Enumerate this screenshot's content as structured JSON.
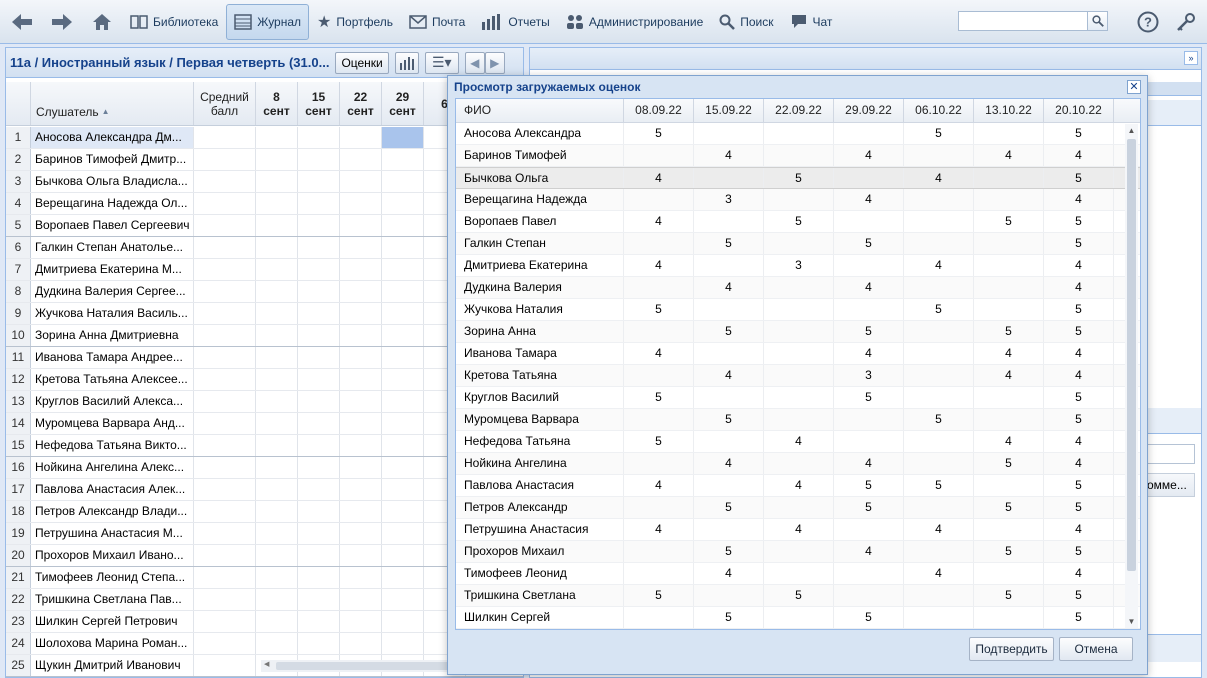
{
  "toolbar": {
    "library": "Библиотека",
    "journal": "Журнал",
    "portfolio": "Портфель",
    "mail": "Почта",
    "reports": "Отчеты",
    "admin": "Администрирование",
    "search": "Поиск",
    "chat": "Чат",
    "search_value": ""
  },
  "journal": {
    "title": "11а / Иностранный язык / Первая четверть (31.0...",
    "grades_button": "Оценки",
    "col_listener": "Слушатель",
    "col_avg_1": "Средний",
    "col_avg_2": "балл",
    "dates": [
      {
        "day": "8",
        "month": "сент"
      },
      {
        "day": "15",
        "month": "сент"
      },
      {
        "day": "22",
        "month": "сент"
      },
      {
        "day": "29",
        "month": "сент"
      },
      {
        "day": "6",
        "month": ""
      }
    ],
    "rows": [
      {
        "n": "1",
        "name": "Аносова Александра Дм..."
      },
      {
        "n": "2",
        "name": "Баринов Тимофей Дмитр..."
      },
      {
        "n": "3",
        "name": "Бычкова Ольга Владисла..."
      },
      {
        "n": "4",
        "name": "Верещагина Надежда Ол..."
      },
      {
        "n": "5",
        "name": "Воропаев Павел Сергеевич"
      },
      {
        "n": "6",
        "name": "Галкин Степан Анатолье..."
      },
      {
        "n": "7",
        "name": "Дмитриева Екатерина М..."
      },
      {
        "n": "8",
        "name": "Дудкина Валерия Сергее..."
      },
      {
        "n": "9",
        "name": "Жучкова Наталия Василь..."
      },
      {
        "n": "10",
        "name": "Зорина Анна Дмитриевна"
      },
      {
        "n": "11",
        "name": "Иванова Тамара Андрее..."
      },
      {
        "n": "12",
        "name": "Кретова Татьяна Алексее..."
      },
      {
        "n": "13",
        "name": "Круглов Василий Алекса..."
      },
      {
        "n": "14",
        "name": "Муромцева Варвара Анд..."
      },
      {
        "n": "15",
        "name": "Нефедова Татьяна Викто..."
      },
      {
        "n": "16",
        "name": "Нойкина Ангелина Алекс..."
      },
      {
        "n": "17",
        "name": "Павлова Анастасия Алек..."
      },
      {
        "n": "18",
        "name": "Петров Александр Влади..."
      },
      {
        "n": "19",
        "name": "Петрушина Анастасия М..."
      },
      {
        "n": "20",
        "name": "Прохоров Михаил Ивано..."
      },
      {
        "n": "21",
        "name": "Тимофеев Леонид Степа..."
      },
      {
        "n": "22",
        "name": "Тришкина Светлана Пав..."
      },
      {
        "n": "23",
        "name": "Шилкин Сергей Петрович"
      },
      {
        "n": "24",
        "name": "Шолохова Марина Роман..."
      },
      {
        "n": "25",
        "name": "Щукин Дмитрий Иванович"
      }
    ]
  },
  "right_panel": {
    "comment_header": "Комме..."
  },
  "modal": {
    "title": "Просмотр загружаемых оценок",
    "col_fio": "ФИО",
    "dates": [
      "08.09.22",
      "15.09.22",
      "22.09.22",
      "29.09.22",
      "06.10.22",
      "13.10.22",
      "20.10.22"
    ],
    "rows": [
      {
        "name": "Аносова Александра",
        "g": [
          "5",
          "",
          "",
          "",
          "5",
          "",
          "5"
        ]
      },
      {
        "name": "Баринов Тимофей",
        "g": [
          "",
          "4",
          "",
          "4",
          "",
          "4",
          "4"
        ]
      },
      {
        "name": "Бычкова Ольга",
        "g": [
          "4",
          "",
          "5",
          "",
          "4",
          "",
          "5"
        ]
      },
      {
        "name": "Верещагина Надежда",
        "g": [
          "",
          "3",
          "",
          "4",
          "",
          "",
          "4"
        ]
      },
      {
        "name": "Воропаев Павел",
        "g": [
          "4",
          "",
          "5",
          "",
          "",
          "5",
          "5"
        ]
      },
      {
        "name": "Галкин Степан",
        "g": [
          "",
          "5",
          "",
          "5",
          "",
          "",
          "5"
        ]
      },
      {
        "name": "Дмитриева Екатерина",
        "g": [
          "4",
          "",
          "3",
          "",
          "4",
          "",
          "4"
        ]
      },
      {
        "name": "Дудкина Валерия",
        "g": [
          "",
          "4",
          "",
          "4",
          "",
          "",
          "4"
        ]
      },
      {
        "name": "Жучкова Наталия",
        "g": [
          "5",
          "",
          "",
          "",
          "5",
          "",
          "5"
        ]
      },
      {
        "name": "Зорина Анна",
        "g": [
          "",
          "5",
          "",
          "5",
          "",
          "5",
          "5"
        ]
      },
      {
        "name": "Иванова Тамара",
        "g": [
          "4",
          "",
          "",
          "4",
          "",
          "4",
          "4"
        ]
      },
      {
        "name": "Кретова Татьяна",
        "g": [
          "",
          "4",
          "",
          "3",
          "",
          "4",
          "4"
        ]
      },
      {
        "name": "Круглов Василий",
        "g": [
          "5",
          "",
          "",
          "5",
          "",
          "",
          "5"
        ]
      },
      {
        "name": "Муромцева Варвара",
        "g": [
          "",
          "5",
          "",
          "",
          "5",
          "",
          "5"
        ]
      },
      {
        "name": "Нефедова Татьяна",
        "g": [
          "5",
          "",
          "4",
          "",
          "",
          "4",
          "4"
        ]
      },
      {
        "name": "Нойкина Ангелина",
        "g": [
          "",
          "4",
          "",
          "4",
          "",
          "5",
          "4"
        ]
      },
      {
        "name": "Павлова Анастасия",
        "g": [
          "4",
          "",
          "4",
          "5",
          "5",
          "",
          "5"
        ]
      },
      {
        "name": "Петров Александр",
        "g": [
          "",
          "5",
          "",
          "5",
          "",
          "5",
          "5"
        ]
      },
      {
        "name": "Петрушина Анастасия",
        "g": [
          "4",
          "",
          "4",
          "",
          "4",
          "",
          "4"
        ]
      },
      {
        "name": "Прохоров Михаил",
        "g": [
          "",
          "5",
          "",
          "4",
          "",
          "5",
          "5"
        ]
      },
      {
        "name": "Тимофеев Леонид",
        "g": [
          "",
          "4",
          "",
          "",
          "4",
          "",
          "4"
        ]
      },
      {
        "name": "Тришкина Светлана",
        "g": [
          "5",
          "",
          "5",
          "",
          "",
          "5",
          "5"
        ]
      },
      {
        "name": "Шилкин Сергей",
        "g": [
          "",
          "5",
          "",
          "5",
          "",
          "",
          "5"
        ]
      }
    ],
    "confirm": "Подтвердить",
    "cancel": "Отмена"
  }
}
